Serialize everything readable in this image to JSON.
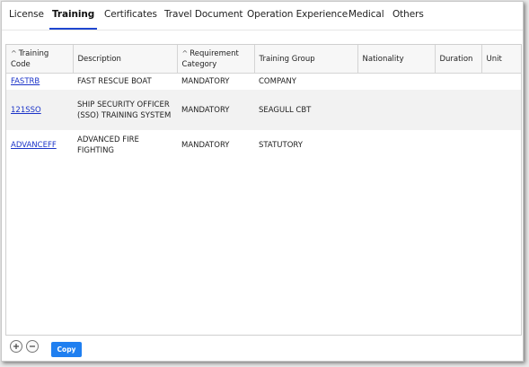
{
  "tabs": [
    {
      "label": "License",
      "active": false
    },
    {
      "label": "Training",
      "active": true
    },
    {
      "label": "Certificates",
      "active": false
    },
    {
      "label": "Travel Document",
      "active": false
    },
    {
      "label": "Operation Experience",
      "active": false
    },
    {
      "label": "Medical",
      "active": false
    },
    {
      "label": "Others",
      "active": false
    }
  ],
  "table": {
    "headers": {
      "training_code_sort": "^",
      "training_code_1": "Training",
      "training_code_2": "Code",
      "description": "Description",
      "requirement_sort": "^",
      "requirement_1": "Requirement",
      "requirement_2": "Category",
      "training_group": "Training Group",
      "nationality": "Nationality",
      "duration": "Duration",
      "unit": "Unit"
    },
    "rows": [
      {
        "code": "FASTRB",
        "description": "FAST RESCUE BOAT",
        "requirement": "MANDATORY",
        "group": "COMPANY",
        "nationality": "",
        "duration": "",
        "unit": ""
      },
      {
        "code": "121SSO",
        "description": "SHIP SECURITY OFFICER (SSO) TRAINING SYSTEM",
        "requirement": "MANDATORY",
        "group": "SEAGULL CBT",
        "nationality": "",
        "duration": "",
        "unit": ""
      },
      {
        "code": "ADVANCEFF",
        "description": "ADVANCED FIRE FIGHTING",
        "requirement": "MANDATORY",
        "group": "STATUTORY",
        "nationality": "",
        "duration": "",
        "unit": ""
      }
    ]
  },
  "footer": {
    "add_icon": "plus-circle-icon",
    "remove_icon": "minus-circle-icon",
    "copy_label": "Copy"
  },
  "colors": {
    "active_tab_underline": "#1f46d0",
    "link": "#1a33c8",
    "copy_button": "#1f7ff0"
  }
}
